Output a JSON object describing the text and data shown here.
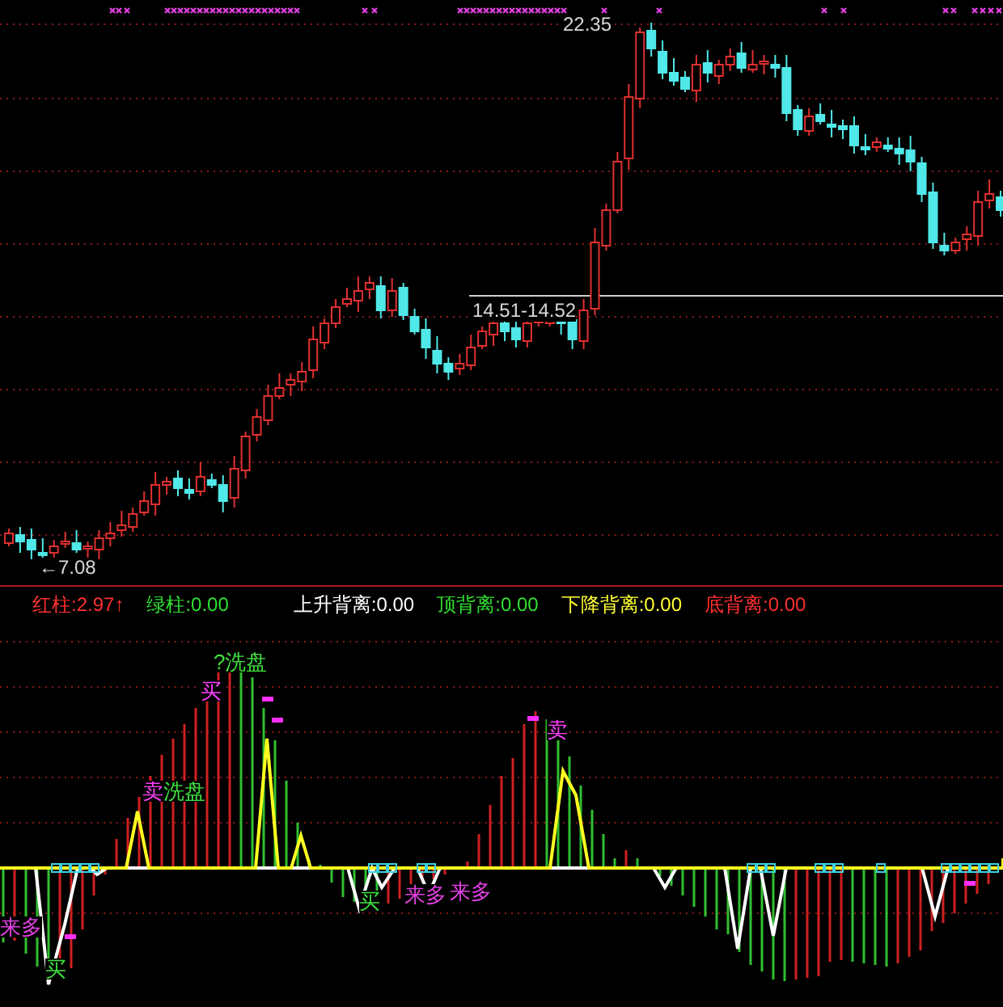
{
  "price_chart": {
    "annotations": [
      {
        "kind": "high",
        "text": "22.35"
      },
      {
        "kind": "range",
        "text": "14.51-14.52"
      },
      {
        "kind": "low",
        "text": "←7.08"
      }
    ]
  },
  "indicator_legend": [
    {
      "label": "红柱",
      "value": ":2.97",
      "arrow": "↑",
      "color": "#ff3030"
    },
    {
      "label": "绿柱",
      "value": ":0.00",
      "color": "#30e030"
    },
    {
      "label": "上升背离",
      "value": ":0.00",
      "color": "#ffffff"
    },
    {
      "label": "顶背离",
      "value": ":0.00",
      "color": "#30e030"
    },
    {
      "label": "下降背离",
      "value": ":0.00",
      "color": "#ffff30"
    },
    {
      "label": "底背离",
      "value": ":0.00",
      "color": "#ff3030"
    }
  ],
  "indicator_chart": {
    "signals": [
      {
        "text": "?洗盘",
        "color": "#40e040"
      },
      {
        "text": "买",
        "color": "#ff40ff"
      },
      {
        "text": "卖",
        "color": "#ff40ff"
      },
      {
        "text": "洗盘",
        "color": "#40e040"
      },
      {
        "text": "卖",
        "color": "#ff40ff"
      },
      {
        "text": "来多",
        "color": "#e040e0"
      },
      {
        "text": "买",
        "color": "#40e040"
      },
      {
        "text": "买",
        "color": "#40e040"
      },
      {
        "text": "来多",
        "color": "#e040e0"
      },
      {
        "text": "来多",
        "color": "#e040e0"
      }
    ]
  }
}
